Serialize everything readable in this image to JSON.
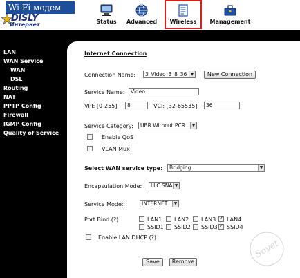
{
  "header": {
    "banner": "Wi-Fi модем",
    "brand": "DISLY",
    "brand_sub": "Интернет",
    "nav": [
      {
        "label": "Status",
        "icon": "monitor-icon"
      },
      {
        "label": "Advanced",
        "icon": "globe-icon"
      },
      {
        "label": "Wireless",
        "icon": "document-icon",
        "highlighted": true
      },
      {
        "label": "Management",
        "icon": "toolbox-icon"
      }
    ]
  },
  "sidebar": {
    "items": [
      {
        "label": "LAN",
        "level": 0
      },
      {
        "label": "WAN Service",
        "level": 0
      },
      {
        "label": "WAN",
        "level": 1
      },
      {
        "label": "DSL",
        "level": 1
      },
      {
        "label": "Routing",
        "level": 0
      },
      {
        "label": "NAT",
        "level": 0
      },
      {
        "label": "PPTP Config",
        "level": 0
      },
      {
        "label": "Firewall",
        "level": 0
      },
      {
        "label": "IGMP Config",
        "level": 0
      },
      {
        "label": "Quality of Service",
        "level": 0
      }
    ]
  },
  "form": {
    "section_title": "Internet Connection",
    "connection_name_label": "Connection Name:",
    "connection_name_value": "3_Video_B_8_36",
    "new_connection_button": "New Connection",
    "service_name_label": "Service Name:",
    "service_name_value": "Video",
    "vpi_label": "VPI: [0-255]",
    "vpi_value": "8",
    "vci_label": "VCI: [32-65535]",
    "vci_value": "36",
    "service_category_label": "Service Category:",
    "service_category_value": "UBR Without PCR",
    "enable_qos_label": "Enable QoS",
    "vlan_mux_label": "VLAN Mux",
    "wan_service_type_label": "Select WAN service type:",
    "wan_service_type_value": "Bridging",
    "encapsulation_label": "Encapsulation Mode:",
    "encapsulation_value": "LLC SNAP",
    "service_mode_label": "Service Mode:",
    "service_mode_value": "INTERNET",
    "port_bind_label": "Port Bind (?):",
    "ports_row1": [
      {
        "label": "LAN1",
        "checked": false
      },
      {
        "label": "LAN2",
        "checked": false
      },
      {
        "label": "LAN3",
        "checked": false
      },
      {
        "label": "LAN4",
        "checked": true
      }
    ],
    "ports_row2": [
      {
        "label": "SSID1",
        "checked": false
      },
      {
        "label": "SSID2",
        "checked": false
      },
      {
        "label": "SSID3",
        "checked": false
      },
      {
        "label": "SSID4",
        "checked": true
      }
    ],
    "enable_lan_dhcp_label": "Enable LAN DHCP (?)",
    "save_button": "Save",
    "remove_button": "Remove"
  },
  "watermark": "Sovet",
  "colors": {
    "banner": "#1b4f9c",
    "highlight_border": "#d42020",
    "sidebar_bg": "#000000"
  }
}
